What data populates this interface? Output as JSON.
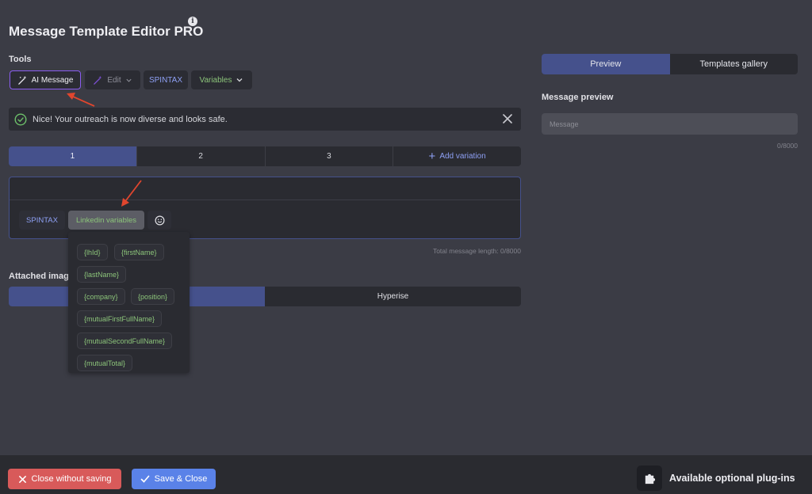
{
  "app": {
    "title": "Message Template Editor PRO",
    "info_glyph": "i"
  },
  "tools": {
    "label": "Tools",
    "ai_message": "AI Message",
    "edit": "Edit",
    "spintax": "SPINTAX",
    "variables": "Variables"
  },
  "alert": {
    "text": "Nice! Your outreach is now diverse and looks safe."
  },
  "variations": {
    "tabs": [
      {
        "label": "1"
      },
      {
        "label": "2"
      },
      {
        "label": "3"
      }
    ],
    "add_label": "Add variation"
  },
  "editor": {
    "spintax": "SPINTAX",
    "linkedin_variables": "Linkedin variables",
    "total_length": "Total message length: 0/8000"
  },
  "linkedin_variables": [
    "{lhId}",
    "{firstName}",
    "{lastName}",
    "{company}",
    "{position}",
    "{mutualFirstFullName}",
    "{mutualSecondFullName}",
    "{mutualTotal}"
  ],
  "attached_images": {
    "label": "Attached imag",
    "tabs": [
      "",
      "Hyperise"
    ]
  },
  "right_panel": {
    "tabs": [
      "Preview",
      "Templates gallery"
    ],
    "message_preview_label": "Message preview",
    "message_placeholder": "Message",
    "message_count": "0/8000"
  },
  "footer": {
    "close_without_saving": "Close without saving",
    "save_close": "Save & Close",
    "plugins": "Available optional plug-ins"
  },
  "colors": {
    "background": "#3b3c45",
    "panel": "#2a2b31",
    "accent_blue": "#45518c",
    "ai_border": "#8a5cf0",
    "spintax_text": "#8ea0f4",
    "variable_text": "#8cc47a",
    "close_button": "#d85a5a",
    "save_button": "#5a82e8",
    "annotation_arrow": "#e0462e"
  }
}
